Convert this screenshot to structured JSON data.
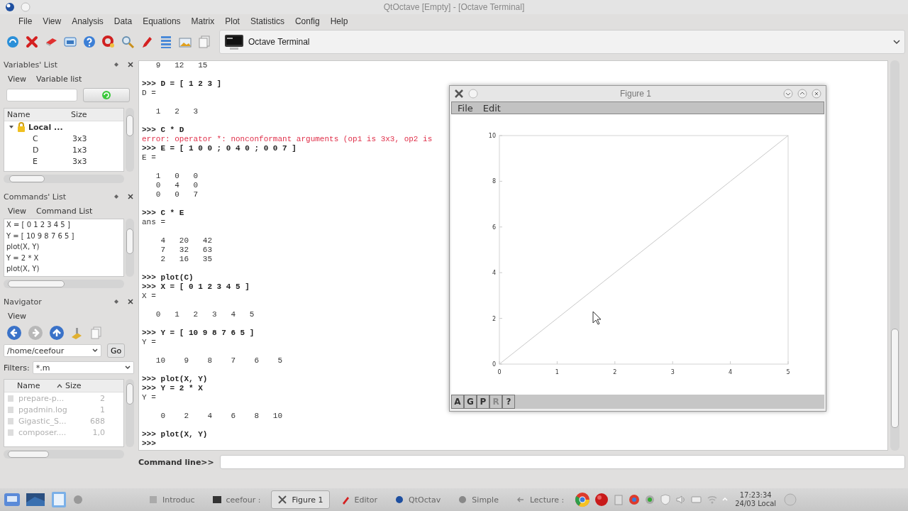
{
  "window": {
    "title": "QtOctave [Empty] - [Octave Terminal]"
  },
  "menu": [
    "File",
    "View",
    "Analysis",
    "Data",
    "Equations",
    "Matrix",
    "Plot",
    "Statistics",
    "Config",
    "Help"
  ],
  "toolbar": {
    "tab": "Octave Terminal"
  },
  "variables_list": {
    "title": "Variables' List",
    "menu": [
      "View",
      "Variable list"
    ],
    "columns": [
      "Name",
      "Size"
    ],
    "tree": [
      {
        "name": "Local ...",
        "expanded": true,
        "children": [
          {
            "name": "C",
            "size": "3x3"
          },
          {
            "name": "D",
            "size": "1x3"
          },
          {
            "name": "E",
            "size": "3x3"
          }
        ]
      }
    ]
  },
  "commands_list": {
    "title": "Commands' List",
    "menu": [
      "View",
      "Command List"
    ],
    "items": [
      "X = [ 0 1 2 3 4 5 ]",
      "Y = [ 10 9 8 7 6 5 ]",
      "plot(X, Y)",
      "Y = 2 * X",
      "plot(X, Y)"
    ]
  },
  "navigator": {
    "title": "Navigator",
    "menu": [
      "View"
    ],
    "nav_buttons": [
      {
        "kind": "back",
        "disabled": false
      },
      {
        "kind": "forward",
        "disabled": true
      },
      {
        "kind": "up",
        "disabled": false
      }
    ],
    "path": "/home/ceefour",
    "go": "Go",
    "filters_label": "Filters:",
    "filter": "*.m",
    "columns": [
      "Name",
      "Size"
    ],
    "files": [
      {
        "name": "prepare-p...",
        "size": "2"
      },
      {
        "name": "pgadmin.log",
        "size": "1"
      },
      {
        "name": "Gigastic_S...",
        "size": "688"
      },
      {
        "name": "composer....",
        "size": "1,0"
      }
    ]
  },
  "terminal": {
    "lines": [
      {
        "kind": "out",
        "text": "   9   12   15"
      },
      {
        "kind": "blank"
      },
      {
        "kind": "cmd",
        "text": ">>> D = [ 1 2 3 ]"
      },
      {
        "kind": "out",
        "text": "D ="
      },
      {
        "kind": "blank"
      },
      {
        "kind": "out",
        "text": "   1   2   3"
      },
      {
        "kind": "blank"
      },
      {
        "kind": "cmd",
        "text": ">>> C * D"
      },
      {
        "kind": "error",
        "text": "error: operator *: nonconformant arguments (op1 is 3x3, op2 is"
      },
      {
        "kind": "cmd",
        "text": ">>> E = [ 1 0 0 ; 0 4 0 ; 0 0 7 ]"
      },
      {
        "kind": "out",
        "text": "E ="
      },
      {
        "kind": "blank"
      },
      {
        "kind": "out",
        "text": "   1   0   0"
      },
      {
        "kind": "out",
        "text": "   0   4   0"
      },
      {
        "kind": "out",
        "text": "   0   0   7"
      },
      {
        "kind": "blank"
      },
      {
        "kind": "cmd",
        "text": ">>> C * E"
      },
      {
        "kind": "out",
        "text": "ans ="
      },
      {
        "kind": "blank"
      },
      {
        "kind": "out",
        "text": "    4   20   42"
      },
      {
        "kind": "out",
        "text": "    7   32   63"
      },
      {
        "kind": "out",
        "text": "    2   16   35"
      },
      {
        "kind": "blank"
      },
      {
        "kind": "cmd",
        "text": ">>> plot(C)"
      },
      {
        "kind": "cmd",
        "text": ">>> X = [ 0 1 2 3 4 5 ]"
      },
      {
        "kind": "out",
        "text": "X ="
      },
      {
        "kind": "blank"
      },
      {
        "kind": "out",
        "text": "   0   1   2   3   4   5"
      },
      {
        "kind": "blank"
      },
      {
        "kind": "cmd",
        "text": ">>> Y = [ 10 9 8 7 6 5 ]"
      },
      {
        "kind": "out",
        "text": "Y ="
      },
      {
        "kind": "blank"
      },
      {
        "kind": "out",
        "text": "   10    9    8    7    6    5"
      },
      {
        "kind": "blank"
      },
      {
        "kind": "cmd",
        "text": ">>> plot(X, Y)"
      },
      {
        "kind": "cmd",
        "text": ">>> Y = 2 * X"
      },
      {
        "kind": "out",
        "text": "Y ="
      },
      {
        "kind": "blank"
      },
      {
        "kind": "out",
        "text": "    0    2    4    6    8   10"
      },
      {
        "kind": "blank"
      },
      {
        "kind": "cmd",
        "text": ">>> plot(X, Y)"
      },
      {
        "kind": "cmd",
        "text": ">>>"
      }
    ]
  },
  "command_line": {
    "label": "Command line>>"
  },
  "figure": {
    "title": "Figure 1",
    "menu": [
      "File",
      "Edit"
    ],
    "chart_data": {
      "type": "line",
      "x": [
        0,
        1,
        2,
        3,
        4,
        5
      ],
      "series": [
        {
          "color": "#c8c8c8",
          "values": [
            0,
            2,
            4,
            6,
            8,
            10
          ]
        }
      ],
      "xlim": [
        0,
        5
      ],
      "ylim": [
        0,
        10
      ],
      "xticks": [
        0,
        1,
        2,
        3,
        4,
        5
      ],
      "yticks": [
        0,
        2,
        4,
        6,
        8,
        10
      ]
    },
    "buttons": [
      {
        "label": "A",
        "disabled": false
      },
      {
        "label": "G",
        "disabled": false
      },
      {
        "label": "P",
        "disabled": false
      },
      {
        "label": "R",
        "disabled": true
      },
      {
        "label": "?",
        "disabled": false
      }
    ]
  },
  "taskbar": {
    "tasks": [
      {
        "label": "Introduc",
        "selected": false
      },
      {
        "label": "ceefour :",
        "selected": false
      },
      {
        "label": "Figure 1",
        "selected": true
      },
      {
        "label": "Editor",
        "selected": false
      },
      {
        "label": "QtOctav",
        "selected": false
      },
      {
        "label": "Simple",
        "selected": false
      },
      {
        "label": "Lecture :",
        "selected": false
      }
    ],
    "clock": {
      "time": "17:23:34",
      "date": "24/03 Local"
    }
  }
}
